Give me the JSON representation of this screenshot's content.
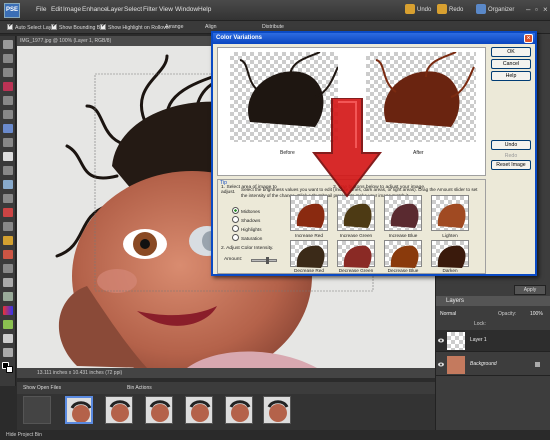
{
  "app": {
    "logo_text": "PSE",
    "menu": [
      "File",
      "Edit",
      "Image",
      "Enhance",
      "Layer",
      "Select",
      "Filter",
      "View",
      "Window",
      "Help"
    ],
    "undo_label": "Undo",
    "redo_label": "Redo",
    "organizer_label": "Organizer"
  },
  "options_bar": {
    "auto_select": "Auto Select Layer",
    "show_bounding": "Show Bounding Box",
    "show_highlight": "Show Highlight on Rollover",
    "arrange": "Arrange",
    "align": "Align",
    "distribute": "Distribute"
  },
  "document": {
    "tab_title": "IMG_1977.jpg @ 100% (Layer 1, RGB/8)",
    "status": "13.111 inches x 10.431 inches (72 ppi)"
  },
  "bin": {
    "show_open_files": "Show Open Files",
    "bin_actions": "Bin Actions",
    "hide_project_bin": "Hide Project Bin"
  },
  "right_panel": {
    "apply_label": "Apply",
    "layers_title": "Layers",
    "blend_mode": "Normal",
    "opacity_label": "Opacity:",
    "opacity_value": "100%",
    "lock_label": "Lock:",
    "layers": [
      {
        "name": "Layer 1"
      },
      {
        "name": "Background"
      }
    ]
  },
  "dialog": {
    "title": "Color Variations",
    "before_label": "Before",
    "after_label": "After",
    "buttons": {
      "ok": "OK",
      "cancel": "Cancel",
      "help": "Help",
      "undo": "Undo",
      "redo": "Redo",
      "reset": "Reset Image"
    },
    "tip_label": "Tip",
    "tip_text": "Select the brightness values you want to edit (middle tones, dark areas, or light areas). Drag the Amount slider to set the intensity of the change. Click a thumbnail preview to make your image match it.",
    "step1": "1. Select area of image to adjust.",
    "step2": "2. Adjust Color Intensity.",
    "step3": "3. Use buttons below to adjust your image.",
    "amount_label": "Amount:",
    "area_options": [
      {
        "label": "Midtones",
        "selected": true
      },
      {
        "label": "Shadows",
        "selected": false
      },
      {
        "label": "Highlights",
        "selected": false
      },
      {
        "label": "Saturation",
        "selected": false
      }
    ],
    "variations": [
      {
        "label": "Increase Red",
        "color": "#8a2a10"
      },
      {
        "label": "Increase Green",
        "color": "#4d3a14"
      },
      {
        "label": "Increase Blue",
        "color": "#5a2a30"
      },
      {
        "label": "Lighten",
        "color": "#a04a22"
      },
      {
        "label": "Decrease Red",
        "color": "#3b2a18"
      },
      {
        "label": "Decrease Green",
        "color": "#8a2a25"
      },
      {
        "label": "Decrease Blue",
        "color": "#8a3a0c"
      },
      {
        "label": "Darken",
        "color": "#3a1a0c"
      }
    ]
  }
}
